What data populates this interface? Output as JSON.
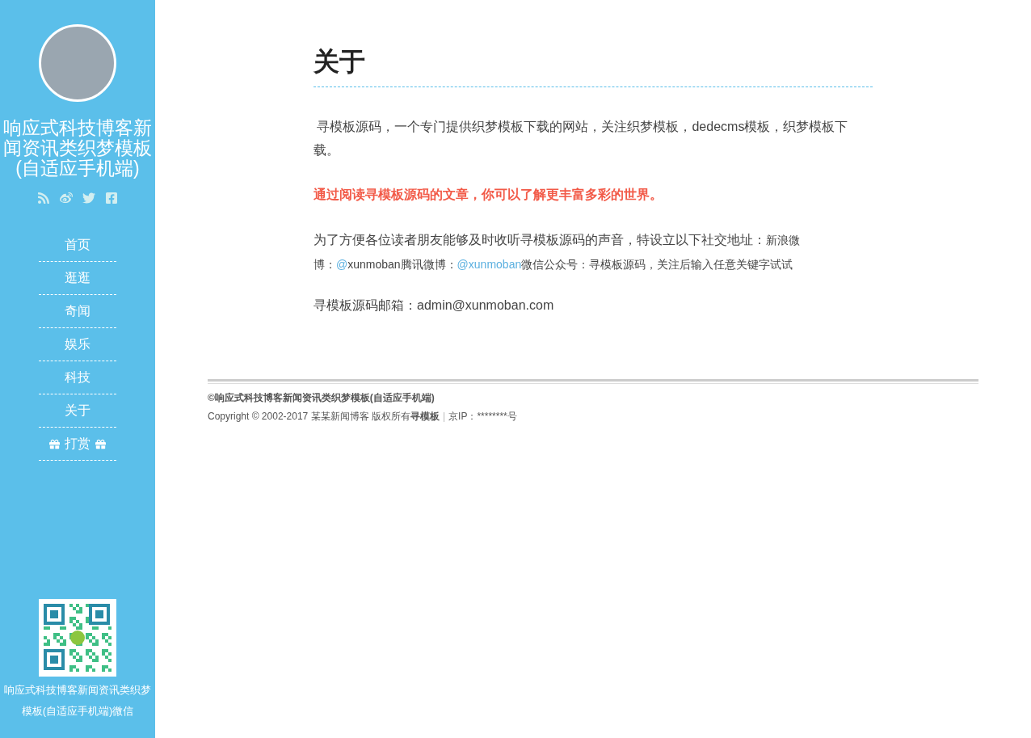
{
  "sidebar": {
    "site_title": "响应式科技博客新闻资讯类织梦模板(自适应手机端)",
    "nav": [
      {
        "label": "首页",
        "kind": "plain"
      },
      {
        "label": "逛逛",
        "kind": "plain"
      },
      {
        "label": "奇闻",
        "kind": "plain"
      },
      {
        "label": "娱乐",
        "kind": "plain"
      },
      {
        "label": "科技",
        "kind": "plain"
      },
      {
        "label": "关于",
        "kind": "plain"
      },
      {
        "label": "打赏",
        "kind": "gift"
      }
    ],
    "qr_caption": "响应式科技博客新闻资讯类织梦模板(自适应手机端)微信"
  },
  "article": {
    "title": "关于",
    "intro": " 寻模板源码，一个专门提供织梦模板下载的网站，关注织梦模板，dedecms模板，织梦模板下载。",
    "highlight": "通过阅读寻模板源码的文章，你可以了解更丰富多彩的世界。",
    "social": [
      {
        "kind": "text",
        "text": "为了方便各位读者朋友能够及时收听寻模板源码的声音，特设立以下社交地址："
      },
      {
        "kind": "small",
        "text": "新浪微博："
      },
      {
        "kind": "link",
        "text": "@"
      },
      {
        "kind": "small",
        "text": "xunmoban腾讯微博："
      },
      {
        "kind": "link",
        "text": "@xunmoban"
      },
      {
        "kind": "small",
        "text": "微信公众号：寻模板源码，关注后输入任意关键字试试"
      }
    ],
    "email": "寻模板源码邮箱：admin@xunmoban.com"
  },
  "footer": {
    "site": "©响应式科技博客新闻资讯类织梦模板(自适应手机端)",
    "copyright": [
      {
        "kind": "text",
        "text": "Copyright © 2002-2017 某某新闻博客 版权所有"
      },
      {
        "kind": "link",
        "text": "寻模板"
      },
      {
        "kind": "sep",
        "text": "|"
      },
      {
        "kind": "text",
        "text": "京IP：********号"
      }
    ]
  }
}
